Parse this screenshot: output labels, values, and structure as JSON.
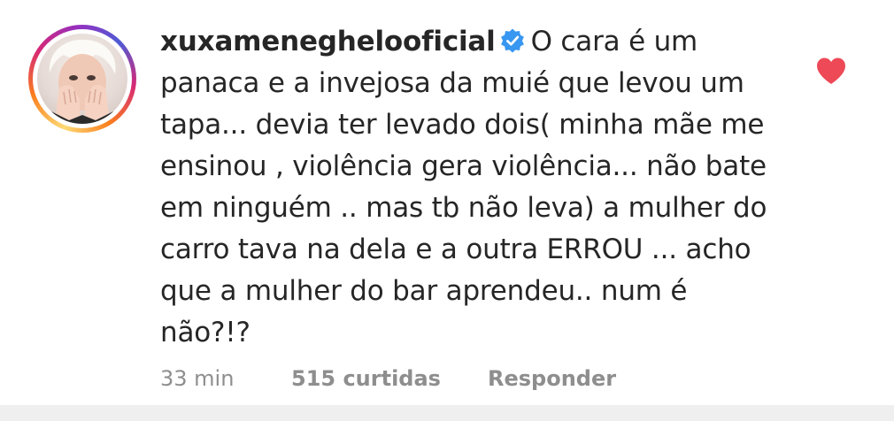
{
  "comment": {
    "username": "xuxameneghelooficial",
    "verified_icon": "verified-badge-icon",
    "text": "O cara é um panaca e a invejosa da muié que levou um tapa... devia ter levado  dois( minha mãe me ensinou , violência gera violência... não bate em ninguém .. mas tb não leva) a mulher do carro  tava na dela e a outra ERROU ... acho que  a mulher do bar aprendeu.. num é não?!?",
    "time": "33 min",
    "likes": "515 curtidas",
    "reply_label": "Responder",
    "liked": true,
    "like_icon": "heart-filled-icon",
    "colors": {
      "heart": "#ed4956",
      "verified": "#3897f0",
      "meta": "#8e8e8e",
      "text": "#262626"
    }
  }
}
